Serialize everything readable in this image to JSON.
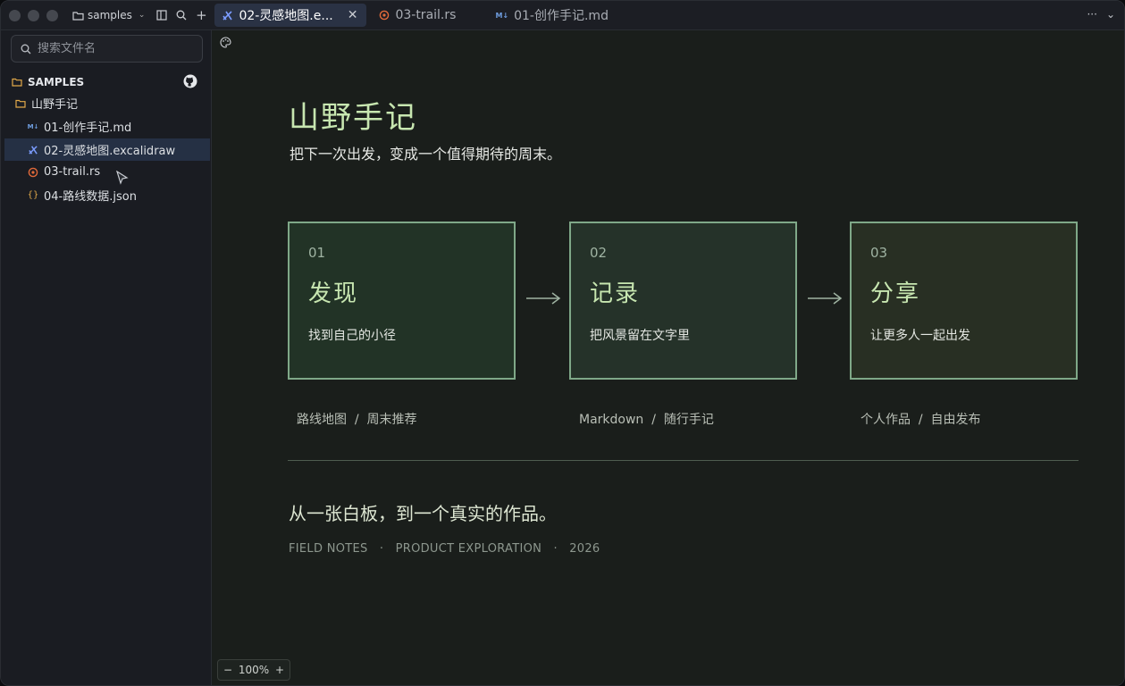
{
  "titlebar": {
    "project": "samples",
    "tabs": [
      {
        "label": "02-灵感地图.e...",
        "active": true
      },
      {
        "label": "03-trail.rs",
        "active": false
      },
      {
        "label": "01-创作手记.md",
        "active": false
      }
    ]
  },
  "sidebar": {
    "search_placeholder": "搜索文件名",
    "root_label": "SAMPLES",
    "folder": "山野手记",
    "files": [
      {
        "label": "01-创作手记.md",
        "icon": "markdown-icon"
      },
      {
        "label": "02-灵感地图.excalidraw",
        "icon": "excalidraw-icon",
        "selected": true
      },
      {
        "label": "03-trail.rs",
        "icon": "rust-icon"
      },
      {
        "label": "04-路线数据.json",
        "icon": "json-icon"
      }
    ]
  },
  "canvas": {
    "title": "山野手记",
    "subtitle": "把下一次出发，变成一个值得期待的周末。",
    "cards": [
      {
        "num": "01",
        "name": "发现",
        "desc": "找到自己的小径",
        "tags": "路线地图  /  周末推荐"
      },
      {
        "num": "02",
        "name": "记录",
        "desc": "把风景留在文字里",
        "tags": "Markdown  /  随行手记"
      },
      {
        "num": "03",
        "name": "分享",
        "desc": "让更多人一起出发",
        "tags": "个人作品  /  自由发布"
      }
    ],
    "tagline": "从一张白板，到一个真实的作品。",
    "footer": "FIELD NOTES   ·   PRODUCT EXPLORATION   ·   2026",
    "zoom": "100%"
  },
  "colors": {
    "accent": "#c7e6b0",
    "card_border": "#7fa888",
    "selection": "#253044"
  }
}
